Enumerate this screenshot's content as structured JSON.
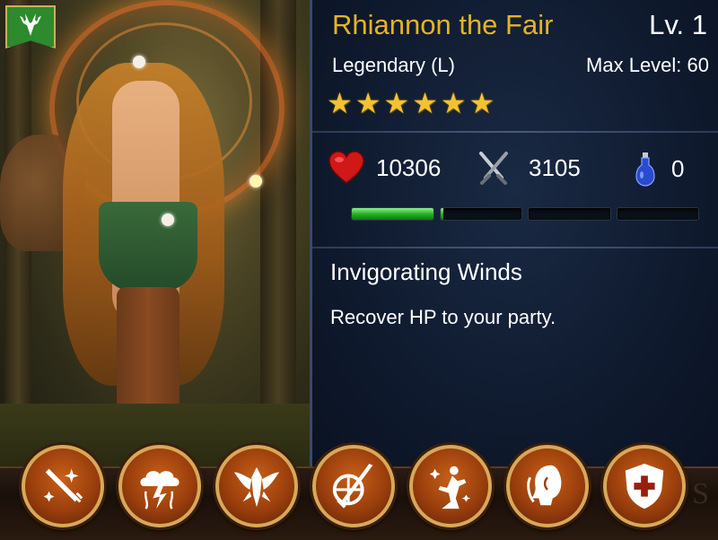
{
  "hero": {
    "name": "Rhiannon the Fair",
    "level": "Lv. 1",
    "rarity": "Legendary (L)",
    "max_level": "Max Level: 60",
    "stars": [
      "★",
      "★",
      "★",
      "★",
      "★",
      "★"
    ]
  },
  "stats": {
    "hp": "10306",
    "attack": "3105",
    "potion": "0"
  },
  "exp_progress": 0.26,
  "skill": {
    "name": "Invigorating Winds",
    "description": "Recover HP to your party."
  },
  "bottom_bg_text": "S",
  "icons": {
    "banner": "deer-emblem-icon",
    "hp": "heart-icon",
    "attack": "crossed-swords-icon",
    "potion": "potion-icon"
  },
  "menu": [
    {
      "icon": "sword-sparkle-icon"
    },
    {
      "icon": "storm-cloud-icon"
    },
    {
      "icon": "winged-helm-icon"
    },
    {
      "icon": "sword-shield-icon"
    },
    {
      "icon": "hero-pose-icon"
    },
    {
      "icon": "face-profile-icon"
    },
    {
      "icon": "cross-shield-icon"
    }
  ],
  "colors": {
    "name": "#e6b422",
    "panel_bg": "#0f1a2e",
    "exp_fill": "#2ab02a",
    "menu_bg": "#9a3e0c",
    "menu_border": "#d8a858",
    "banner": "#2d8a2d"
  }
}
